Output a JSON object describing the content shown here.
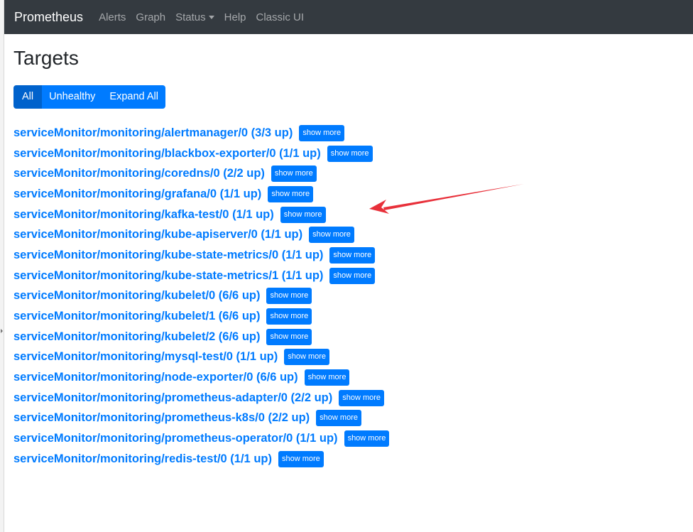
{
  "navbar": {
    "brand": "Prometheus",
    "items": [
      {
        "label": "Alerts"
      },
      {
        "label": "Graph"
      },
      {
        "label": "Status"
      },
      {
        "label": "Help"
      },
      {
        "label": "Classic UI"
      }
    ]
  },
  "page": {
    "title": "Targets",
    "filters": [
      {
        "label": "All",
        "active": true
      },
      {
        "label": "Unhealthy",
        "active": false
      },
      {
        "label": "Expand All",
        "active": false
      }
    ],
    "show_more_label": "show more"
  },
  "targets": [
    {
      "label": "serviceMonitor/monitoring/alertmanager/0 (3/3 up)"
    },
    {
      "label": "serviceMonitor/monitoring/blackbox-exporter/0 (1/1 up)"
    },
    {
      "label": "serviceMonitor/monitoring/coredns/0 (2/2 up)"
    },
    {
      "label": "serviceMonitor/monitoring/grafana/0 (1/1 up)"
    },
    {
      "label": "serviceMonitor/monitoring/kafka-test/0 (1/1 up)"
    },
    {
      "label": "serviceMonitor/monitoring/kube-apiserver/0 (1/1 up)"
    },
    {
      "label": "serviceMonitor/monitoring/kube-state-metrics/0 (1/1 up)"
    },
    {
      "label": "serviceMonitor/monitoring/kube-state-metrics/1 (1/1 up)"
    },
    {
      "label": "serviceMonitor/monitoring/kubelet/0 (6/6 up)"
    },
    {
      "label": "serviceMonitor/monitoring/kubelet/1 (6/6 up)"
    },
    {
      "label": "serviceMonitor/monitoring/kubelet/2 (6/6 up)"
    },
    {
      "label": "serviceMonitor/monitoring/mysql-test/0 (1/1 up)"
    },
    {
      "label": "serviceMonitor/monitoring/node-exporter/0 (6/6 up)"
    },
    {
      "label": "serviceMonitor/monitoring/prometheus-adapter/0 (2/2 up)"
    },
    {
      "label": "serviceMonitor/monitoring/prometheus-k8s/0 (2/2 up)"
    },
    {
      "label": "serviceMonitor/monitoring/prometheus-operator/0 (1/1 up)"
    },
    {
      "label": "serviceMonitor/monitoring/redis-test/0 (1/1 up)"
    }
  ],
  "colors": {
    "navbar_bg": "#343a40",
    "primary": "#007bff",
    "primary_active": "#0062cc",
    "annotation_arrow": "#e8303a"
  },
  "icons": {
    "status_caret": "chevron-down-icon",
    "annotation": "red-arrow-icon"
  }
}
